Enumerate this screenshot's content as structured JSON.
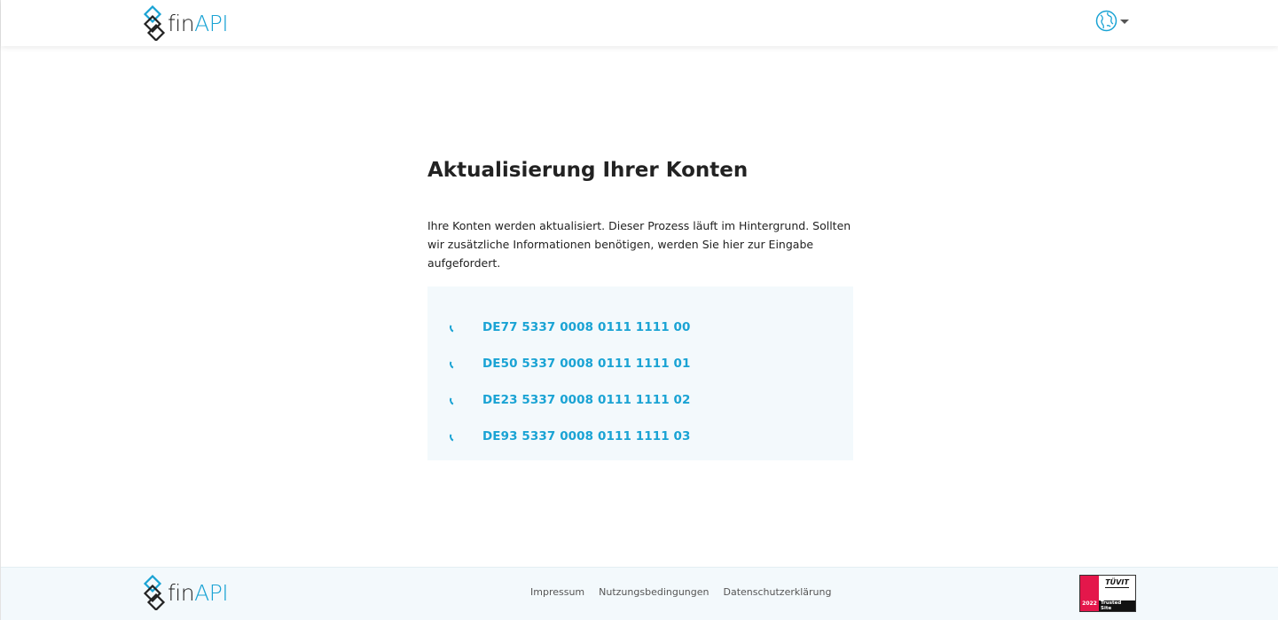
{
  "header": {
    "logo": {
      "fin": "fin",
      "api": "API"
    },
    "language_icon": "globe-icon"
  },
  "main": {
    "title": "Aktualisierung Ihrer Konten",
    "description": "Ihre Konten werden aktualisiert. Dieser Prozess läuft im Hintergrund. Sollten wir zusätzliche Informationen benötigen, werden Sie hier zur Eingabe aufgefordert.",
    "accounts": [
      {
        "iban": "DE77 5337 0008 0111 1111 00",
        "status_icon": "loading-spinner-icon"
      },
      {
        "iban": "DE50 5337 0008 0111 1111 01",
        "status_icon": "loading-spinner-icon"
      },
      {
        "iban": "DE23 5337 0008 0111 1111 02",
        "status_icon": "loading-spinner-icon"
      },
      {
        "iban": "DE93 5337 0008 0111 1111 03",
        "status_icon": "loading-spinner-icon"
      }
    ]
  },
  "footer": {
    "logo": {
      "fin": "fin",
      "api": "API"
    },
    "links": {
      "impressum": "Impressum",
      "nutzungsbedingungen": "Nutzungsbedingungen",
      "datenschutz": "Datenschutzerklärung"
    },
    "badge": {
      "brand": "TÜVIT",
      "label": "Trusted Site",
      "year": "2022"
    }
  },
  "colors": {
    "accent": "#1aa3d4",
    "panel_background": "#f3f9fc",
    "text": "#222222"
  }
}
